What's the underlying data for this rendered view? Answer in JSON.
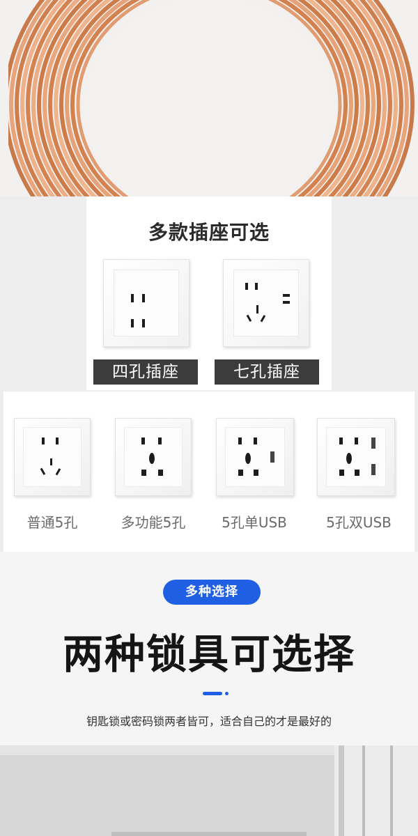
{
  "top_panel": {
    "title": "多款插座可选",
    "four_hole_label": "四孔插座",
    "seven_hole_label": "七孔插座"
  },
  "row_panel": {
    "items": [
      {
        "label": "普通5孔"
      },
      {
        "label": "多功能5孔"
      },
      {
        "label": "5孔单USB"
      },
      {
        "label": "5孔双USB"
      }
    ]
  },
  "heading": {
    "badge": "多种选择",
    "title": "两种锁具可选择",
    "subtitle": "钥匙锁或密码锁两者皆可，适合自己的才是最好的"
  },
  "colors": {
    "accent": "#1f5fe3",
    "copper": "#d98a5a",
    "label_dark": "#3c3c3c"
  }
}
